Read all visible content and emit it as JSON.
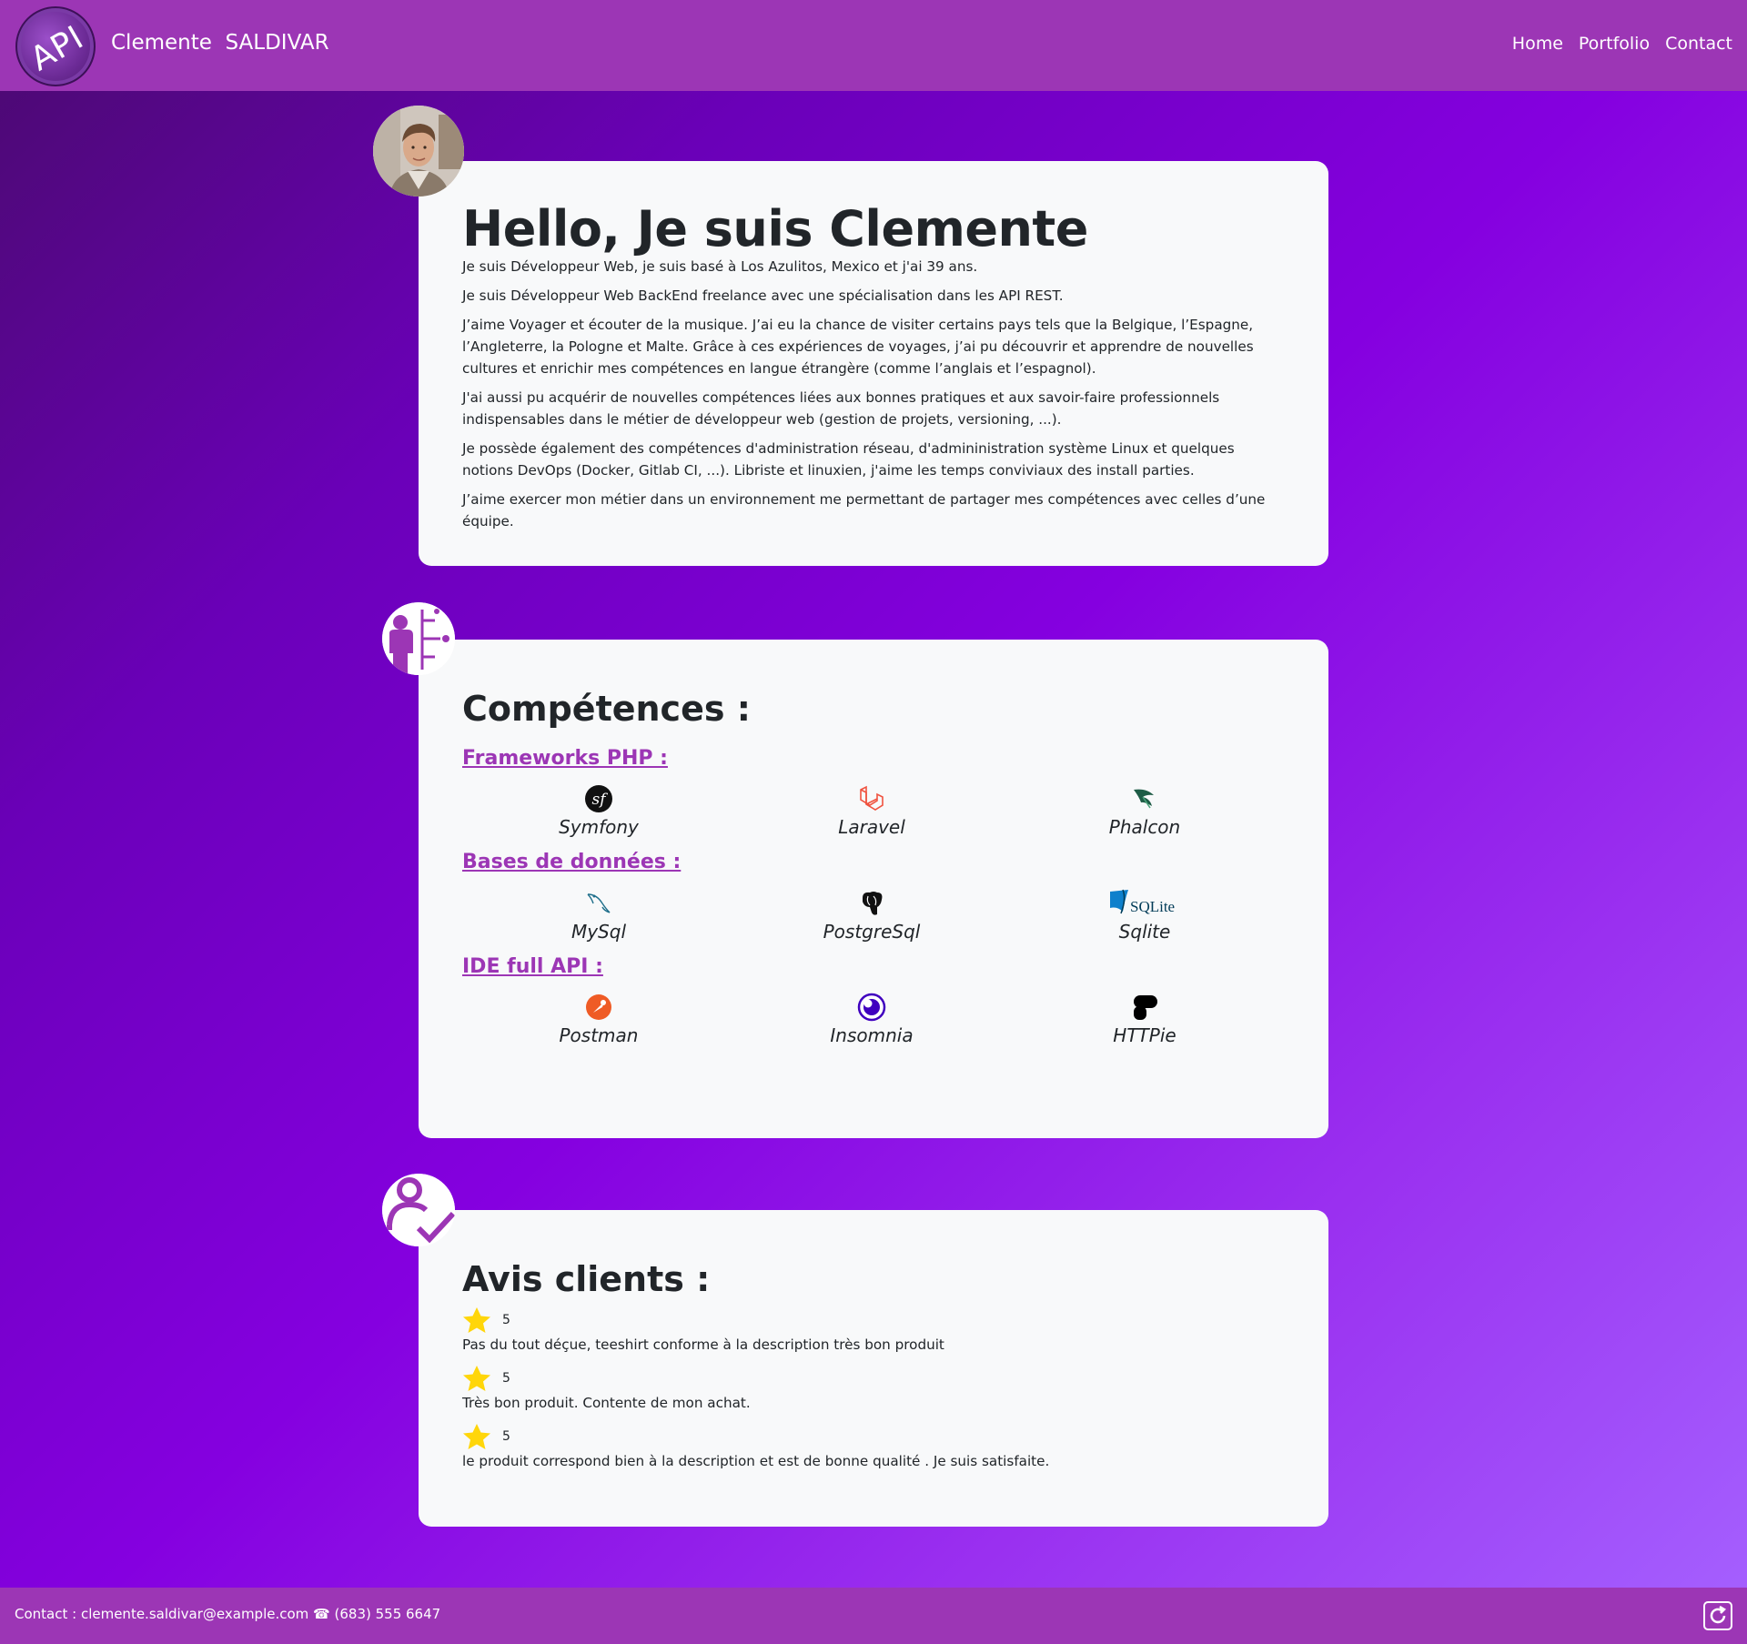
{
  "navbar": {
    "logo_text": "API",
    "brand": "Clemente  SALDIVAR",
    "links": [
      "Home",
      "Portfolio",
      "Contact"
    ]
  },
  "about": {
    "title": "Hello, Je suis Clemente",
    "paragraphs": [
      "Je suis Développeur Web, je suis basé à Los Azulitos, Mexico et j'ai 39 ans.",
      "Je suis Développeur Web BackEnd freelance avec une spécialisation dans les API REST.",
      "J’aime Voyager et écouter de la musique. J’ai eu la chance de visiter certains pays tels que la Belgique, l’Espagne, l’Angleterre, la Pologne et Malte. Grâce à ces expériences de voyages, j’ai pu découvrir et apprendre de nouvelles cultures et enrichir mes compétences en langue étrangère (comme l’anglais et l’espagnol).",
      "J'ai aussi pu acquérir de nouvelles compétences liées aux bonnes pratiques et aux savoir-faire professionnels indispensables dans le métier de développeur web (gestion de projets, versioning, ...).",
      "Je possède également des compétences d'administration réseau, d'admininistration système Linux et quelques notions DevOps (Docker, Gitlab CI, ...). Libriste et linuxien, j'aime les temps conviviaux des install parties.",
      "J’aime exercer mon métier dans un environnement me permettant de partager mes compétences avec celles d’une équipe."
    ]
  },
  "skills": {
    "title": "Compétences :",
    "categories": [
      {
        "title": "Frameworks PHP :",
        "items": [
          {
            "name": "Symfony",
            "icon": "symfony-icon"
          },
          {
            "name": "Laravel",
            "icon": "laravel-icon"
          },
          {
            "name": "Phalcon",
            "icon": "phalcon-icon"
          }
        ]
      },
      {
        "title": "Bases de données :",
        "items": [
          {
            "name": "MySql",
            "icon": "mysql-icon"
          },
          {
            "name": "PostgreSql",
            "icon": "postgresql-icon"
          },
          {
            "name": "Sqlite",
            "icon": "sqlite-icon"
          }
        ]
      },
      {
        "title": "IDE full API :",
        "items": [
          {
            "name": "Postman",
            "icon": "postman-icon"
          },
          {
            "name": "Insomnia",
            "icon": "insomnia-icon"
          },
          {
            "name": "HTTPie",
            "icon": "httpie-icon"
          }
        ]
      }
    ]
  },
  "reviews": {
    "title": "Avis clients :",
    "items": [
      {
        "rating": "5",
        "text": "Pas du tout déçue, teeshirt conforme à la description très bon produit"
      },
      {
        "rating": "5",
        "text": "Très bon produit. Contente de mon achat."
      },
      {
        "rating": "5",
        "text": "le produit correspond bien à la description et est de bonne qualité . Je suis satisfaite."
      }
    ]
  },
  "footer": {
    "contact": "Contact : clemente.saldivar@example.com ☎ (683) 555 6647"
  },
  "colors": {
    "accent": "#9c36b5",
    "card_bg": "#f8f9fa",
    "star": "#ffd60a"
  },
  "sqlite_logo_text": "SQLite"
}
